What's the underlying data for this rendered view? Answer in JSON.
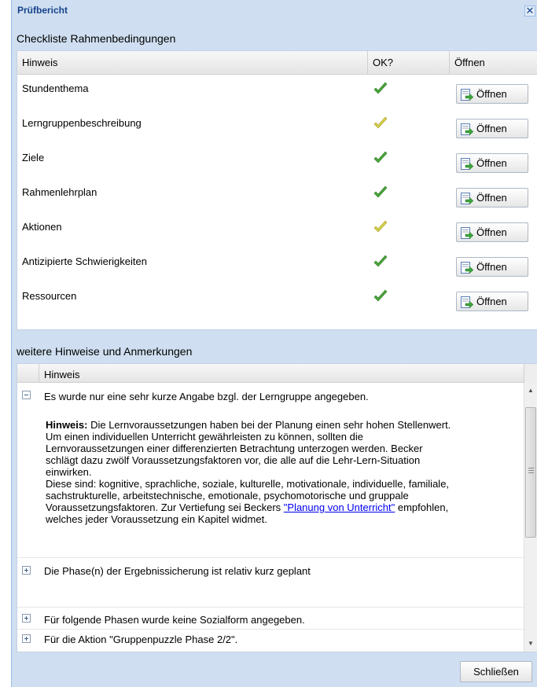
{
  "window": {
    "title": "Prüfbericht",
    "close_symbol": "✕"
  },
  "checklist": {
    "section_title": "Checkliste Rahmenbedingungen",
    "columns": {
      "hinweis": "Hinweis",
      "ok": "OK?",
      "open": "Öffnen"
    },
    "open_label": "Öffnen",
    "rows": [
      {
        "label": "Stundenthema",
        "status": "ok",
        "check_color": "#4aa53a"
      },
      {
        "label": "Lerngruppenbeschreibung",
        "status": "warning",
        "check_color": "#d6cf4a"
      },
      {
        "label": "Ziele",
        "status": "ok",
        "check_color": "#4aa53a"
      },
      {
        "label": "Rahmenlehrplan",
        "status": "ok",
        "check_color": "#4aa53a"
      },
      {
        "label": "Aktionen",
        "status": "warning",
        "check_color": "#d6cf4a"
      },
      {
        "label": "Antizipierte Schwierigkeiten",
        "status": "ok",
        "check_color": "#4aa53a"
      },
      {
        "label": "Ressourcen",
        "status": "ok",
        "check_color": "#4aa53a"
      }
    ]
  },
  "notes": {
    "section_title": "weitere Hinweise und Anmerkungen",
    "column_label": "Hinweis",
    "items": [
      {
        "text": "Es wurde nur eine sehr kurze Angabe bzgl. der Lerngruppe angegeben.",
        "expanded": true,
        "detail": {
          "bold_label": "Hinweis:",
          "line1": " Die Lernvoraussetzungen haben bei der Planung einen sehr hohen Stellenwert.",
          "line2": "Um einen individuellen Unterricht gewährleisten zu können, sollten die",
          "line3": "Lernvoraussetzungen einer differenzierten Betrachtung unterzogen werden. Becker",
          "line4": "schlägt dazu zwölf Voraussetzungsfaktoren vor, die alle auf die Lehr-Lern-Situation",
          "line5": "einwirken.",
          "line6": "Diese sind: kognitive, sprachliche, soziale, kulturelle, motivationale, individuelle, familiale,",
          "line7": "sachstrukturelle, arbeitstechnische, emotionale, psychomotorische und gruppale",
          "line8_pre": "Voraussetzungsfaktoren. Zur Vertiefung sei Beckers ",
          "link_text": "\"Planung von Unterricht\"",
          "line8_post": " empfohlen,",
          "line9": "welches jeder Voraussetzung ein Kapitel widmet."
        }
      },
      {
        "text": "Die Phase(n) der Ergebnissicherung ist relativ kurz geplant",
        "expanded": false
      },
      {
        "text": "Für folgende Phasen wurde keine Sozialform angegeben.",
        "expanded": false
      },
      {
        "text": "Für die Aktion \"Gruppenpuzzle Phase 2/2\".",
        "expanded": false
      }
    ]
  },
  "footer": {
    "close_label": "Schließen"
  }
}
